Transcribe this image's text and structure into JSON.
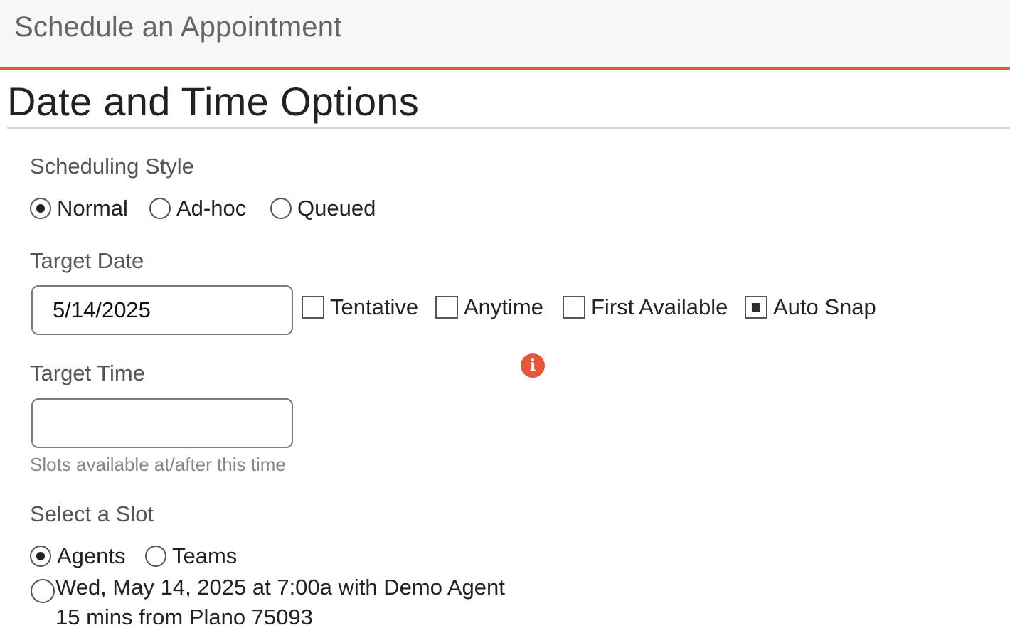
{
  "header": {
    "title": "Schedule an Appointment"
  },
  "section": {
    "title": "Date and Time Options"
  },
  "scheduling_style": {
    "label": "Scheduling Style",
    "options": [
      "Normal",
      "Ad-hoc",
      "Queued"
    ],
    "selected": "Normal"
  },
  "target_date": {
    "label": "Target Date",
    "value": "5/14/2025",
    "checkboxes": [
      {
        "label": "Tentative",
        "checked": false
      },
      {
        "label": "Anytime",
        "checked": false
      },
      {
        "label": "First Available",
        "checked": false
      },
      {
        "label": "Auto Snap",
        "checked": true
      }
    ]
  },
  "target_time": {
    "label": "Target Time",
    "value": "",
    "help": "Slots available at/after this time",
    "info_icon": "info-icon"
  },
  "select_slot": {
    "label": "Select a Slot",
    "options": [
      "Agents",
      "Teams"
    ],
    "selected": "Agents",
    "slots": [
      {
        "line1": "Wed, May 14, 2025 at 7:00a with Demo Agent",
        "line2": "15 mins from Plano 75093",
        "selected": false
      }
    ]
  },
  "colors": {
    "accent": "#e5573b",
    "header_bg": "#f7f7f7"
  }
}
